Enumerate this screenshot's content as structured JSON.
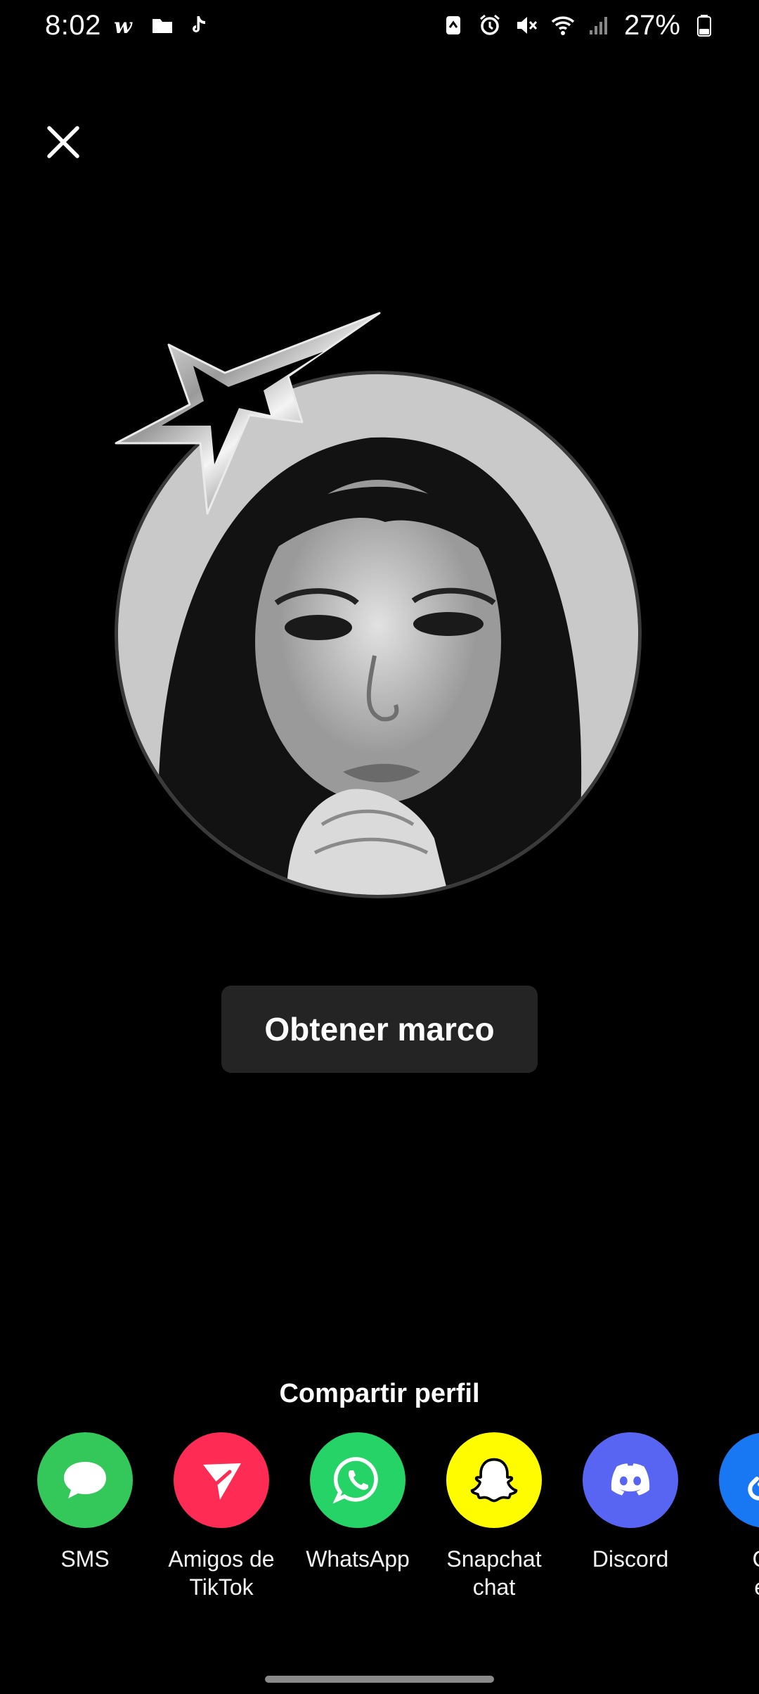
{
  "status_bar": {
    "time": "8:02",
    "battery": "27%",
    "left_icons": [
      "wattpad-icon",
      "folder-icon",
      "tiktok-icon"
    ],
    "right_icons": [
      "nfc-icon",
      "alarm-icon",
      "mute-icon",
      "wifi-icon",
      "signal-icon",
      "battery-icon"
    ]
  },
  "main": {
    "get_frame_label": "Obtener marco"
  },
  "share": {
    "title": "Compartir perfil",
    "items": [
      {
        "label": "SMS",
        "color": "#34C759",
        "icon": "sms-icon"
      },
      {
        "label": "Amigos de TikTok",
        "color": "#FE2C55",
        "icon": "tiktok-friends-icon"
      },
      {
        "label": "WhatsApp",
        "color": "#25D366",
        "icon": "whatsapp-icon"
      },
      {
        "label": "Snapchat chat",
        "color": "#FFFC00",
        "icon": "snapchat-icon"
      },
      {
        "label": "Discord",
        "color": "#5865F2",
        "icon": "discord-icon"
      },
      {
        "label": "Co en",
        "color": "#1877F2",
        "icon": "copy-link-icon"
      }
    ]
  }
}
